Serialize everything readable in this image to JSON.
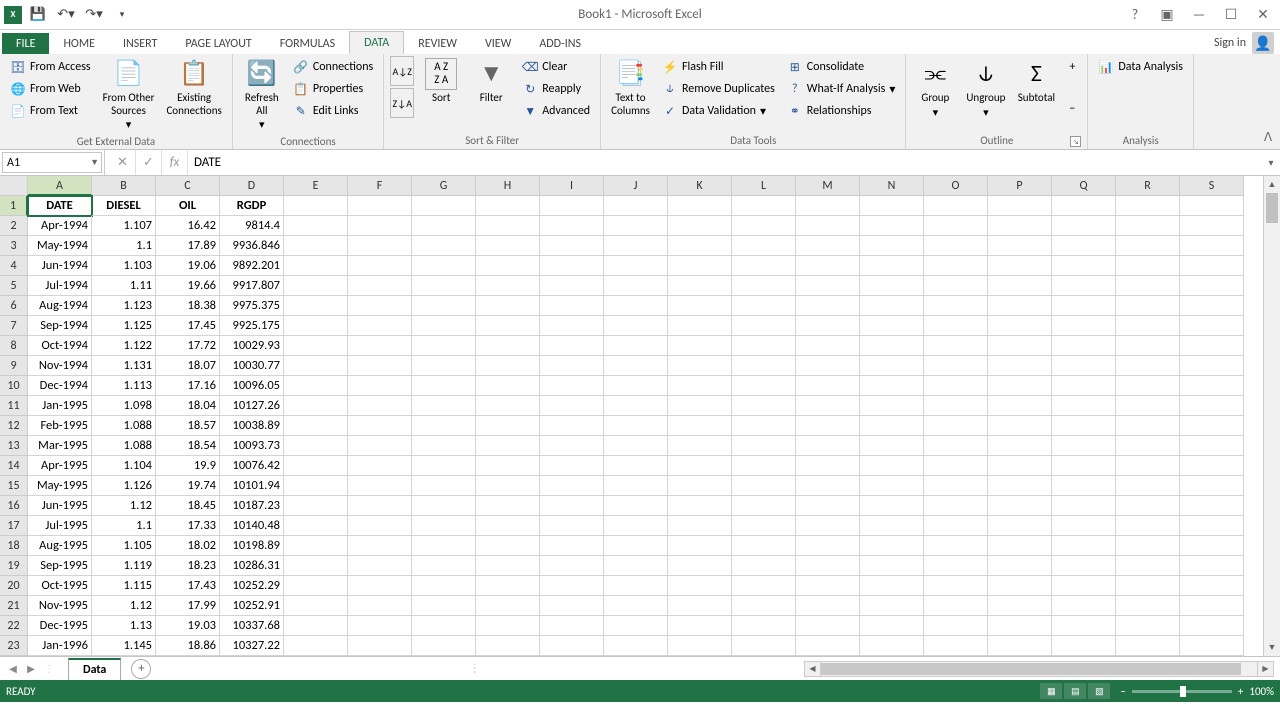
{
  "title": "Book1 - Microsoft Excel",
  "qat": {
    "undo": "↶",
    "redo": "↷"
  },
  "signin": "Sign in",
  "tabs": [
    "FILE",
    "HOME",
    "INSERT",
    "PAGE LAYOUT",
    "FORMULAS",
    "DATA",
    "REVIEW",
    "VIEW",
    "ADD-INS"
  ],
  "activeTab": "DATA",
  "ribbon": {
    "getExternal": {
      "label": "Get External Data",
      "fromAccess": "From Access",
      "fromWeb": "From Web",
      "fromText": "From Text",
      "fromOther": "From Other\nSources",
      "existing": "Existing\nConnections"
    },
    "connections": {
      "label": "Connections",
      "refresh": "Refresh\nAll",
      "conn": "Connections",
      "prop": "Properties",
      "edit": "Edit Links"
    },
    "sortFilter": {
      "label": "Sort & Filter",
      "sort": "Sort",
      "filter": "Filter",
      "clear": "Clear",
      "reapply": "Reapply",
      "advanced": "Advanced"
    },
    "dataTools": {
      "label": "Data Tools",
      "textCol": "Text to\nColumns",
      "flash": "Flash Fill",
      "dup": "Remove Duplicates",
      "valid": "Data Validation",
      "consol": "Consolidate",
      "whatif": "What-If Analysis",
      "rel": "Relationships"
    },
    "outline": {
      "label": "Outline",
      "group": "Group",
      "ungroup": "Ungroup",
      "subtotal": "Subtotal"
    },
    "analysis": {
      "label": "Analysis",
      "da": "Data Analysis"
    }
  },
  "nameBox": "A1",
  "formula": "DATE",
  "columns": [
    "A",
    "B",
    "C",
    "D",
    "E",
    "F",
    "G",
    "H",
    "I",
    "J",
    "K",
    "L",
    "M",
    "N",
    "O",
    "P",
    "Q",
    "R",
    "S"
  ],
  "headerRow": [
    "DATE",
    "DIESEL",
    "OIL",
    "RGDP"
  ],
  "rows": [
    [
      "Apr-1994",
      "1.107",
      "16.42",
      "9814.4"
    ],
    [
      "May-1994",
      "1.1",
      "17.89",
      "9936.846"
    ],
    [
      "Jun-1994",
      "1.103",
      "19.06",
      "9892.201"
    ],
    [
      "Jul-1994",
      "1.11",
      "19.66",
      "9917.807"
    ],
    [
      "Aug-1994",
      "1.123",
      "18.38",
      "9975.375"
    ],
    [
      "Sep-1994",
      "1.125",
      "17.45",
      "9925.175"
    ],
    [
      "Oct-1994",
      "1.122",
      "17.72",
      "10029.93"
    ],
    [
      "Nov-1994",
      "1.131",
      "18.07",
      "10030.77"
    ],
    [
      "Dec-1994",
      "1.113",
      "17.16",
      "10096.05"
    ],
    [
      "Jan-1995",
      "1.098",
      "18.04",
      "10127.26"
    ],
    [
      "Feb-1995",
      "1.088",
      "18.57",
      "10038.89"
    ],
    [
      "Mar-1995",
      "1.088",
      "18.54",
      "10093.73"
    ],
    [
      "Apr-1995",
      "1.104",
      "19.9",
      "10076.42"
    ],
    [
      "May-1995",
      "1.126",
      "19.74",
      "10101.94"
    ],
    [
      "Jun-1995",
      "1.12",
      "18.45",
      "10187.23"
    ],
    [
      "Jul-1995",
      "1.1",
      "17.33",
      "10140.48"
    ],
    [
      "Aug-1995",
      "1.105",
      "18.02",
      "10198.89"
    ],
    [
      "Sep-1995",
      "1.119",
      "18.23",
      "10286.31"
    ],
    [
      "Oct-1995",
      "1.115",
      "17.43",
      "10252.29"
    ],
    [
      "Nov-1995",
      "1.12",
      "17.99",
      "10252.91"
    ],
    [
      "Dec-1995",
      "1.13",
      "19.03",
      "10337.68"
    ],
    [
      "Jan-1996",
      "1.145",
      "18.86",
      "10327.22"
    ]
  ],
  "sheet": "Data",
  "status": "READY",
  "zoom": "100%"
}
